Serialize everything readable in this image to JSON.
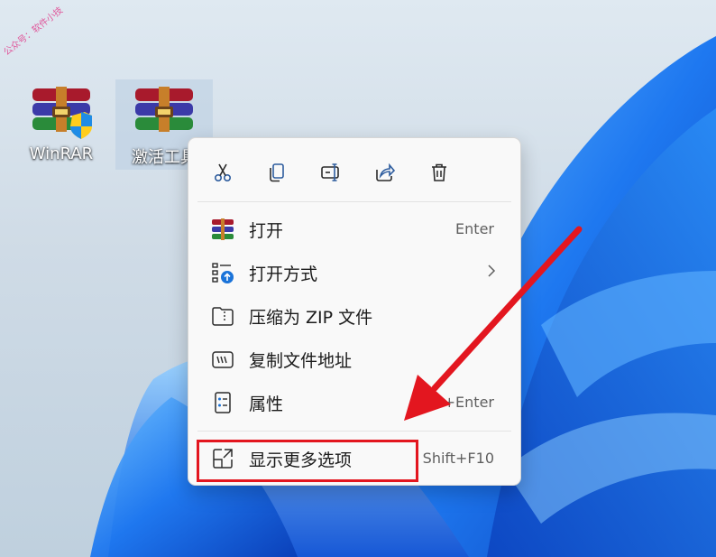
{
  "watermark": "公众号：软件小技",
  "desktop": {
    "icons": [
      {
        "label": "WinRAR"
      },
      {
        "label": "激活工具"
      }
    ]
  },
  "context_menu": {
    "toolbar": [
      {
        "icon": "scissors-icon"
      },
      {
        "icon": "copy-icon"
      },
      {
        "icon": "rename-icon"
      },
      {
        "icon": "share-icon"
      },
      {
        "icon": "trash-icon"
      }
    ],
    "items": [
      {
        "label": "打开",
        "shortcut": "Enter",
        "icon": "winrar-icon"
      },
      {
        "label": "打开方式",
        "shortcut": "",
        "icon": "open-with-icon",
        "submenu": true
      },
      {
        "label": "压缩为 ZIP 文件",
        "shortcut": "",
        "icon": "zip-folder-icon"
      },
      {
        "label": "复制文件地址",
        "shortcut": "",
        "icon": "copy-path-icon"
      },
      {
        "label": "属性",
        "shortcut": "Alt+Enter",
        "icon": "properties-icon"
      },
      {
        "label": "显示更多选项",
        "shortcut": "Shift+F10",
        "icon": "show-more-icon"
      }
    ]
  },
  "annotation": {
    "color": "#e3161f"
  }
}
